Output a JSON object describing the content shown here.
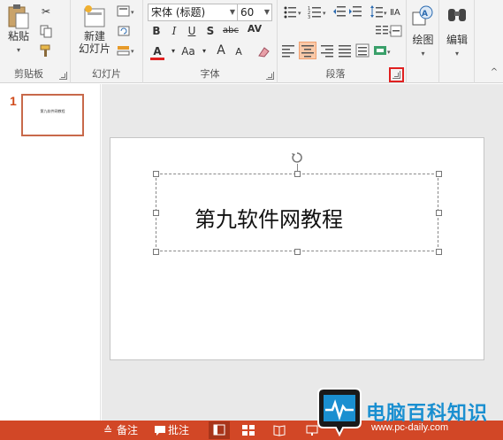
{
  "ribbon": {
    "clipboard": {
      "paste_label": "粘贴",
      "group_label": "剪贴板"
    },
    "slides": {
      "new_slide_line1": "新建",
      "new_slide_line2": "幻灯片",
      "group_label": "幻灯片"
    },
    "font": {
      "font_name": "宋体 (标题)",
      "font_size": "60",
      "group_label": "字体",
      "bold": "B",
      "italic": "I",
      "underline": "U",
      "shadow": "S",
      "strike": "abc",
      "spacing": "AV",
      "font_color": "A",
      "change_case": "Aa",
      "grow": "A",
      "shrink": "A"
    },
    "paragraph": {
      "group_label": "段落"
    },
    "drawing": {
      "label": "绘图"
    },
    "editing": {
      "label": "编辑"
    }
  },
  "thumbnails": {
    "slide_number": "1",
    "thumb_text": "第九软件网教程"
  },
  "slide": {
    "title": "第九软件网教程"
  },
  "statusbar": {
    "notes": "备注",
    "comments": "批注"
  },
  "watermark": {
    "name": "电脑百科知识",
    "url": "www.pc-daily.com"
  },
  "colors": {
    "accent": "#d24726",
    "highlight_box": "#e02020",
    "watermark_blue": "#1a8fd0"
  }
}
